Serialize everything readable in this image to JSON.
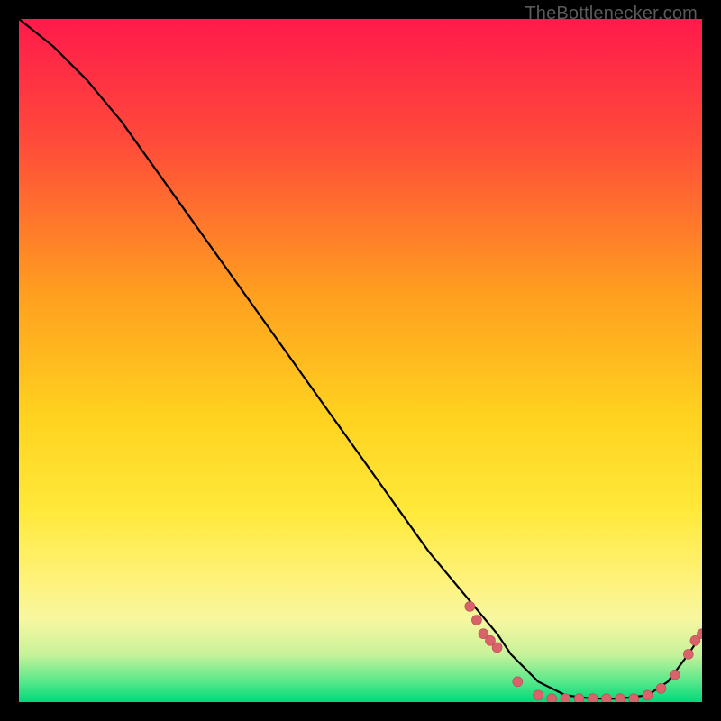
{
  "watermark": "TheBottlenecker.com",
  "chart_data": {
    "type": "line",
    "title": "",
    "xlabel": "",
    "ylabel": "",
    "xlim": [
      0,
      100
    ],
    "ylim": [
      0,
      100
    ],
    "grid": false,
    "background_gradient": [
      "#ff1744",
      "#ff8a00",
      "#ffe500",
      "#fff59d",
      "#00e676"
    ],
    "x": [
      0,
      5,
      10,
      15,
      20,
      25,
      30,
      35,
      40,
      45,
      50,
      55,
      60,
      65,
      70,
      72,
      76,
      80,
      84,
      88,
      92,
      95,
      98,
      100
    ],
    "values": [
      100,
      96,
      91,
      85,
      78,
      71,
      64,
      57,
      50,
      43,
      36,
      29,
      22,
      16,
      10,
      7,
      3,
      1,
      0.5,
      0.5,
      1,
      3,
      7,
      10
    ],
    "markers": {
      "x": [
        66,
        67,
        68,
        69,
        70,
        73,
        76,
        78,
        80,
        82,
        84,
        86,
        88,
        90,
        92,
        94,
        96,
        98,
        99,
        100
      ],
      "values": [
        14,
        12,
        10,
        9,
        8,
        3,
        1,
        0.5,
        0.5,
        0.5,
        0.5,
        0.5,
        0.5,
        0.5,
        1,
        2,
        4,
        7,
        9,
        10
      ]
    }
  }
}
